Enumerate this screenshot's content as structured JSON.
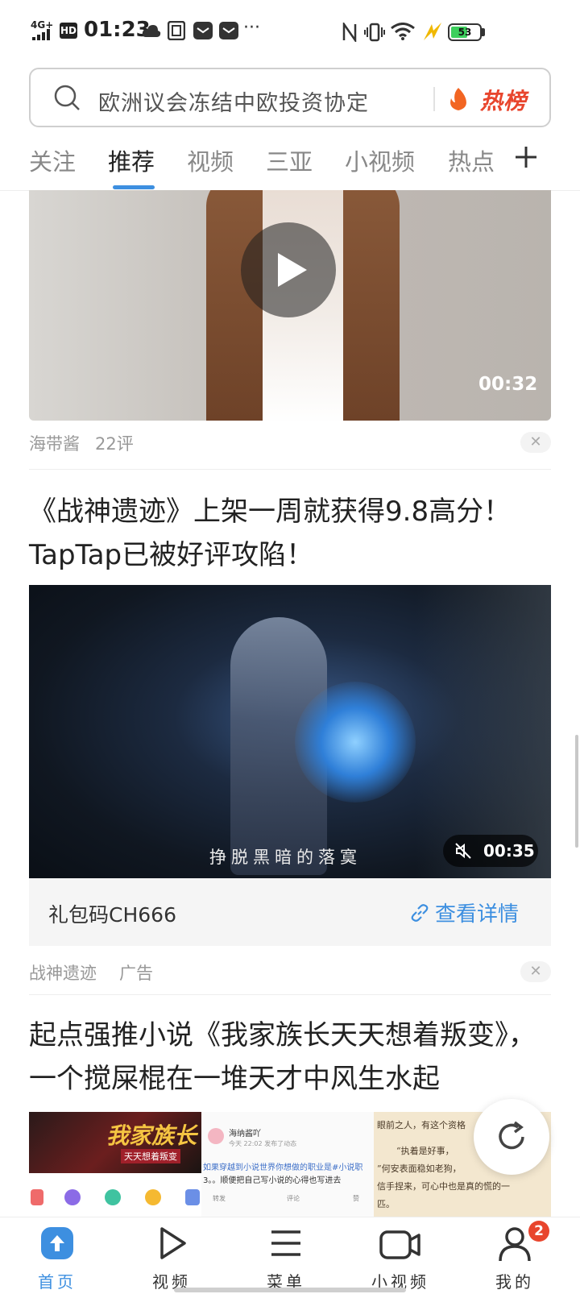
{
  "status_bar": {
    "network": "4G+",
    "hd": "HD",
    "time": "01:23",
    "battery": "53"
  },
  "search": {
    "query": "欧洲议会冻结中欧投资协定",
    "hot_label": "热榜"
  },
  "tabs": [
    {
      "label": "关注"
    },
    {
      "label": "推荐"
    },
    {
      "label": "视频"
    },
    {
      "label": "三亚"
    },
    {
      "label": "小视频"
    },
    {
      "label": "热点"
    }
  ],
  "feed": {
    "item1": {
      "duration": "00:32",
      "source": "海带酱",
      "comments": "22评"
    },
    "item2": {
      "title_line1": "《战神遗迹》上架一周就获得9.8高分！",
      "title_line2": "TapTap已被好评攻陷！",
      "subtitle_overlay": "挣脱黑暗的落寞",
      "duration": "00:35",
      "gift_code": "礼包码CH666",
      "detail_link": "查看详情",
      "source": "战神遗迹",
      "ad_label": "广告"
    },
    "item3": {
      "title_line1": "起点强推小说《我家族长天天想着叛变》，",
      "title_line2": "一个搅屎棍在一堆天才中风生水起",
      "thumb1_text": "我家族长",
      "thumb1_sub": "天天想着叛变",
      "thumb2_user": "海纳酱吖",
      "thumb2_time": "今天 22:02 发布了动态",
      "thumb2_line1": "如果穿越到小说世界你想做的职业是#小说职",
      "thumb2_line2": "3。。顺便把自己写小说的心得也写进去",
      "thumb2_actions": [
        "转发",
        "评论",
        "赞"
      ],
      "thumb3_line1": "眼前之人，有这个资格",
      "thumb3_line2": "“执着是好事，",
      "thumb3_line3": "”何安表面稳如老狗，",
      "thumb3_line4": "信手捏来，可心中也是真的慌的一",
      "thumb3_line5": "匹。"
    }
  },
  "bottom_nav": [
    {
      "label": "首页"
    },
    {
      "label": "视频"
    },
    {
      "label": "菜单"
    },
    {
      "label": "小视频"
    },
    {
      "label": "我的"
    }
  ],
  "notification_badge": "2",
  "colors": {
    "accent": "#3d8fe0",
    "hot": "#e8452d"
  }
}
